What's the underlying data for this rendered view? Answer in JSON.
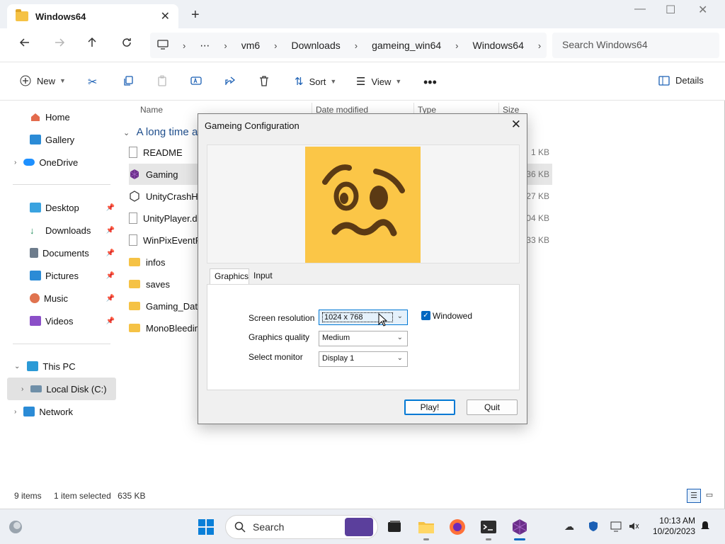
{
  "explorer": {
    "tab_title": "Windows64",
    "breadcrumbs": [
      "vm6",
      "Downloads",
      "gameing_win64",
      "Windows64"
    ],
    "breadcrumb_ellipsis": "⋯",
    "search_placeholder": "Search Windows64",
    "toolbar": {
      "new": "New",
      "sort": "Sort",
      "view": "View",
      "details": "Details"
    },
    "sidebar": {
      "home": "Home",
      "gallery": "Gallery",
      "onedrive": "OneDrive",
      "desktop": "Desktop",
      "downloads": "Downloads",
      "documents": "Documents",
      "pictures": "Pictures",
      "music": "Music",
      "videos": "Videos",
      "this_pc": "This PC",
      "local_disk": "Local Disk (C:)",
      "network": "Network"
    },
    "columns": {
      "name": "Name",
      "date_modified": "Date modified",
      "type": "Type",
      "size": "Size"
    },
    "group_label": "A long time a",
    "files": [
      {
        "name": "README",
        "size": "1 KB",
        "icon": "document-icon"
      },
      {
        "name": "Gaming",
        "size": "636 KB",
        "icon": "unity-game-icon"
      },
      {
        "name": "UnityCrashHa",
        "size": "427 KB",
        "icon": "unity-icon"
      },
      {
        "name": "UnityPlayer.dl",
        "size": "304 KB",
        "icon": "dll-icon"
      },
      {
        "name": "WinPixEventRu",
        "size": "33 KB",
        "icon": "dll-icon"
      },
      {
        "name": "infos",
        "size": "",
        "icon": "folder-icon"
      },
      {
        "name": "saves",
        "size": "",
        "icon": "folder-icon"
      },
      {
        "name": "Gaming_Data",
        "size": "",
        "icon": "folder-icon"
      },
      {
        "name": "MonoBleeding",
        "size": "",
        "icon": "folder-icon"
      }
    ],
    "status": {
      "items": "9 items",
      "selected": "1 item selected",
      "selected_size": "635 KB"
    }
  },
  "dialog": {
    "title": "Gameing Configuration",
    "tabs": [
      "Graphics",
      "Input"
    ],
    "active_tab": "Graphics",
    "fields": {
      "screen_resolution_label": "Screen resolution",
      "screen_resolution_value": "1024 x 768",
      "graphics_quality_label": "Graphics quality",
      "graphics_quality_value": "Medium",
      "select_monitor_label": "Select monitor",
      "select_monitor_value": "Display 1",
      "windowed_label": "Windowed",
      "windowed_checked": true
    },
    "buttons": {
      "play": "Play!",
      "quit": "Quit"
    },
    "banner_colors": {
      "face": "#fbc647",
      "features": "#5b3a14"
    }
  },
  "taskbar": {
    "search_label": "Search",
    "time": "10:13 AM",
    "date": "10/20/2023"
  },
  "colors": {
    "accent": "#0067c0",
    "selection": "#e6e6e6"
  }
}
